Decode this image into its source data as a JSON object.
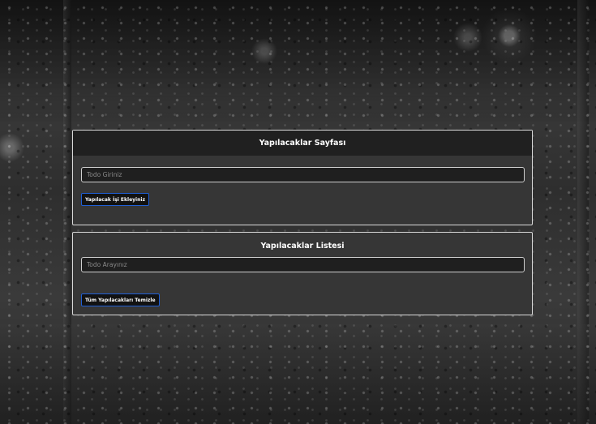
{
  "todo_form": {
    "title": "Yapılacaklar Sayfası",
    "input_placeholder": "Todo Giriniz",
    "input_value": "",
    "add_button_label": "Yapılacak İşi Ekleyiniz"
  },
  "todo_list": {
    "title": "Yapılacaklar Listesi",
    "search_placeholder": "Todo Arayınız",
    "search_value": "",
    "items": [],
    "clear_button_label": "Tüm Yapılacakları Temizle"
  },
  "colors": {
    "button_border": "#1f5fd6",
    "card_background": "#363636",
    "card_header_background": "#202020",
    "card_border": "#d9d9d9"
  }
}
